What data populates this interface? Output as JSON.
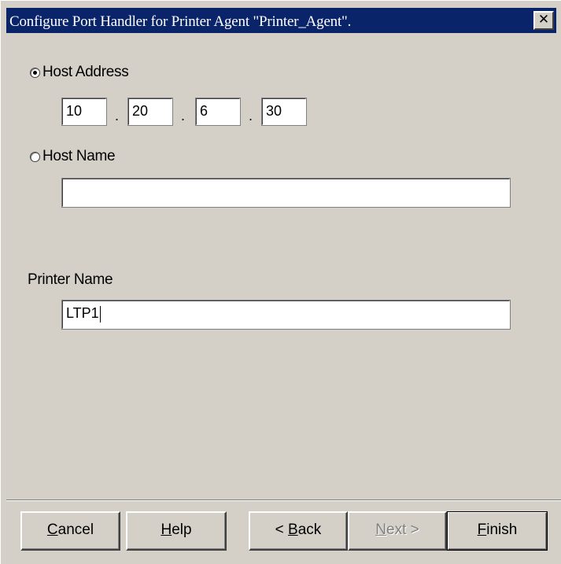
{
  "window": {
    "title": "Configure Port Handler for Printer Agent \"Printer_Agent\".",
    "close_glyph": "✕"
  },
  "host_address": {
    "label": "Host Address",
    "selected": true,
    "octets": [
      "10",
      "20",
      "6",
      "30"
    ],
    "separator": "."
  },
  "host_name": {
    "label": "Host Name",
    "selected": false,
    "value": ""
  },
  "printer_name": {
    "label": "Printer Name",
    "value": "LTP1"
  },
  "buttons": {
    "cancel": {
      "mnemonic": "C",
      "rest": "ancel"
    },
    "help": {
      "mnemonic": "H",
      "rest": "elp"
    },
    "back": {
      "prefix": "< ",
      "mnemonic": "B",
      "rest": "ack"
    },
    "next": {
      "mnemonic": "N",
      "rest": "ext >",
      "enabled": false
    },
    "finish": {
      "mnemonic": "F",
      "rest": "inish"
    }
  },
  "colors": {
    "dialog_bg": "#d4d0c8",
    "titlebar_bg": "#0a246a",
    "titlebar_text": "#ffffff",
    "disabled_text": "#808080"
  }
}
